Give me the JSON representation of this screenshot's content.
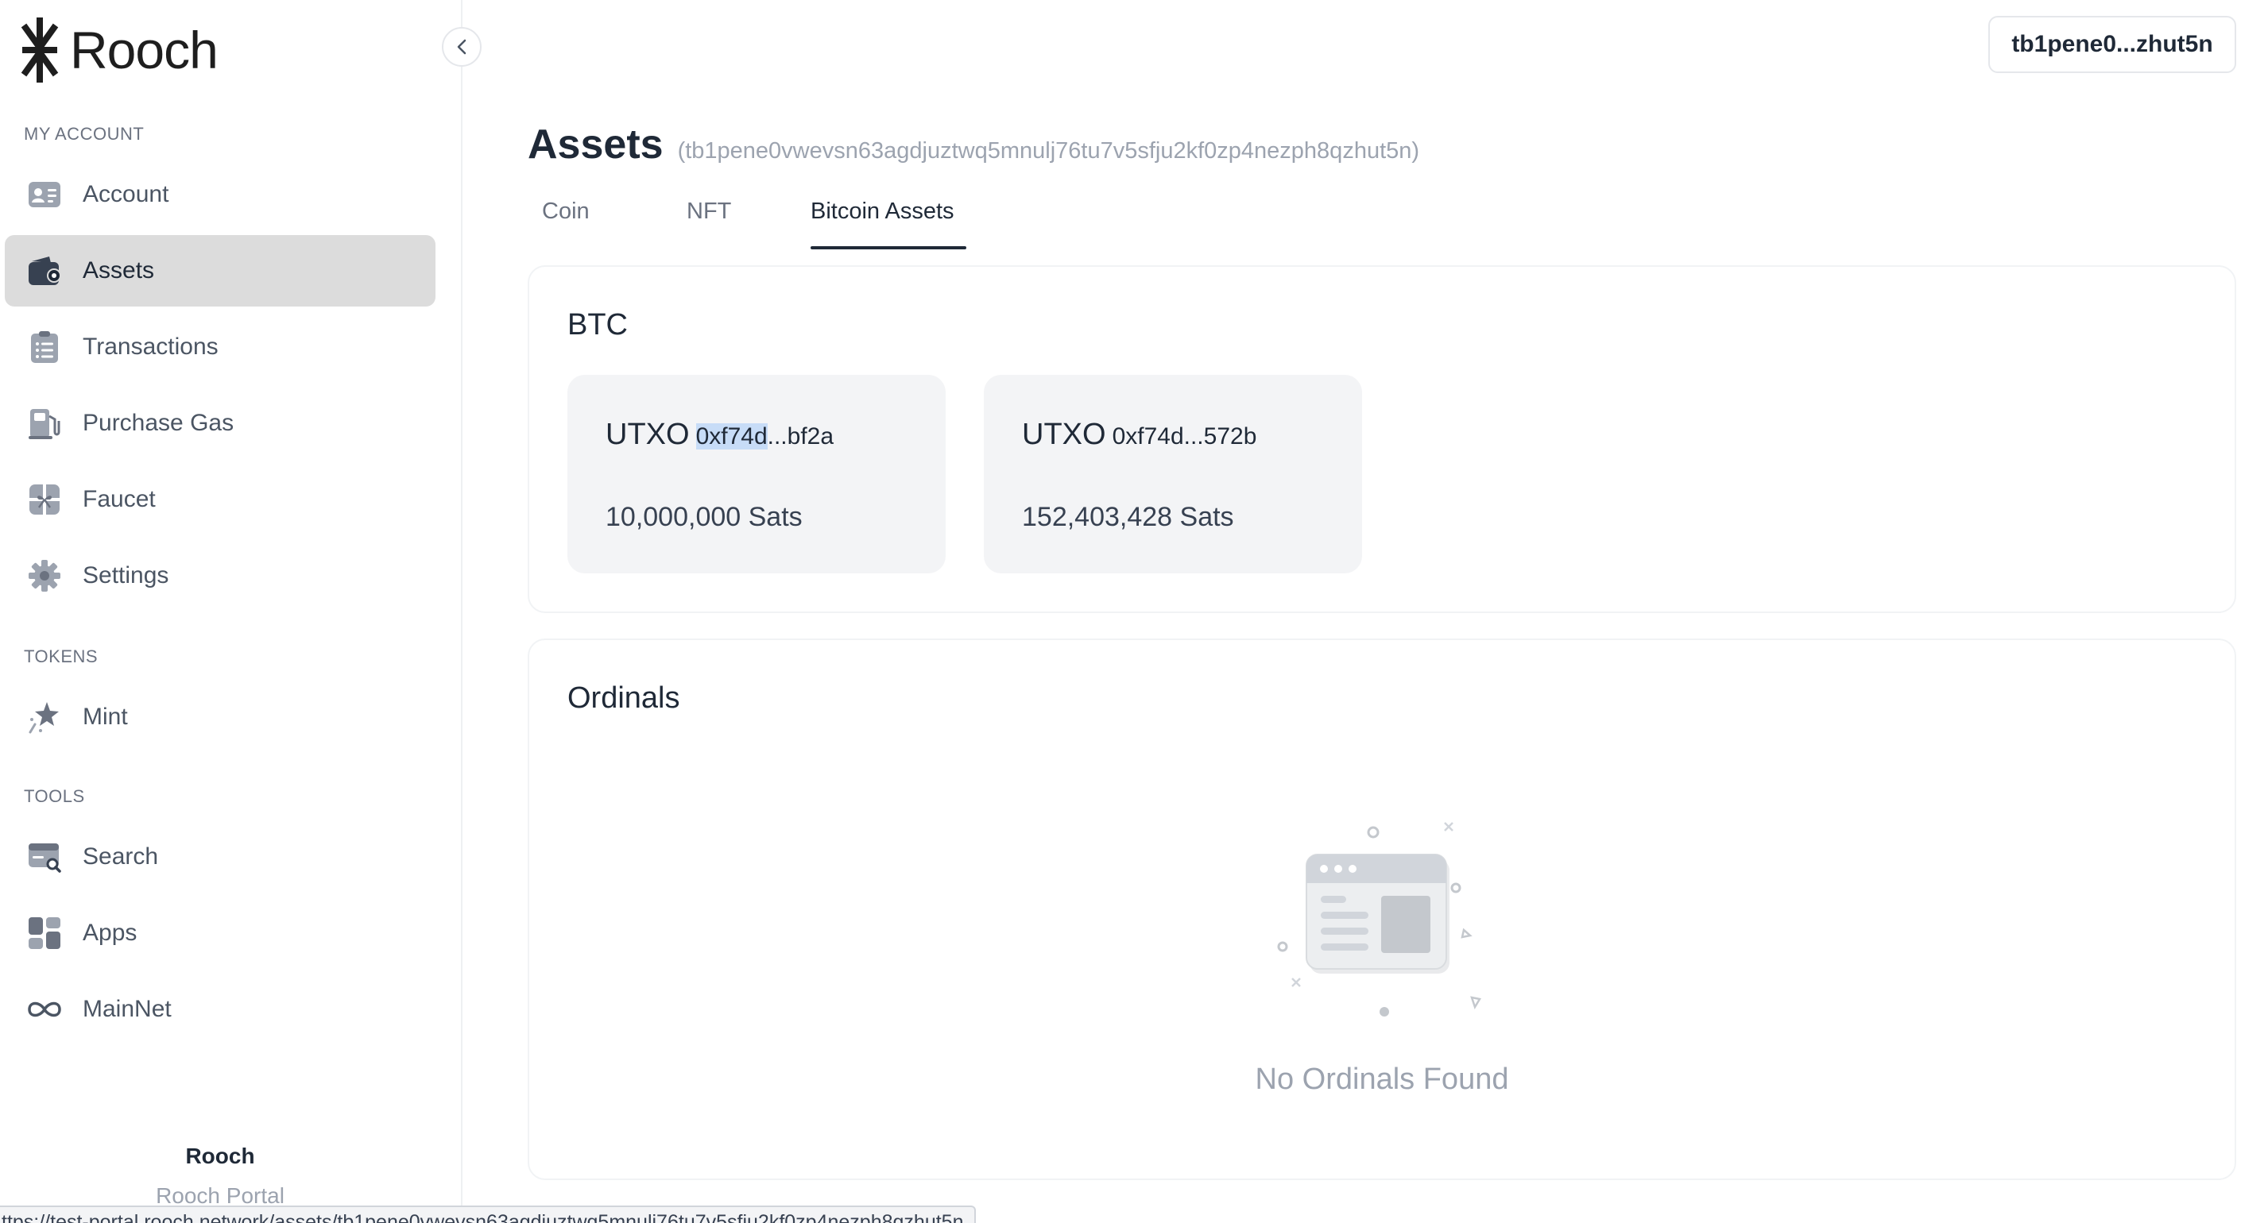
{
  "app": {
    "logo_text": "Rooch",
    "footer_title": "Rooch",
    "footer_subtitle": "Rooch Portal"
  },
  "sidebar": {
    "sections": {
      "my_account": "MY ACCOUNT",
      "tokens": "TOKENS",
      "tools": "TOOLS"
    },
    "items": [
      {
        "label": "Account",
        "icon": "account-card-icon"
      },
      {
        "label": "Assets",
        "icon": "wallet-icon",
        "active": true
      },
      {
        "label": "Transactions",
        "icon": "clipboard-list-icon"
      },
      {
        "label": "Purchase Gas",
        "icon": "gas-pump-icon"
      },
      {
        "label": "Faucet",
        "icon": "faucet-gift-icon"
      },
      {
        "label": "Settings",
        "icon": "gear-icon"
      },
      {
        "label": "Mint",
        "icon": "sparkle-star-icon"
      },
      {
        "label": "Search",
        "icon": "search-browser-icon"
      },
      {
        "label": "Apps",
        "icon": "apps-grid-icon"
      },
      {
        "label": "MainNet",
        "icon": "infinity-icon"
      }
    ]
  },
  "header": {
    "wallet_address_short": "tb1pene0...zhut5n"
  },
  "main": {
    "title": "Assets",
    "address": "(tb1pene0vwevsn63agdjuztwq5mnulj76tu7v5sfju2kf0zp4nezph8qzhut5n)",
    "tabs": [
      {
        "label": "Coin"
      },
      {
        "label": "NFT"
      },
      {
        "label": "Bitcoin Assets",
        "active": true
      }
    ],
    "btc": {
      "title": "BTC",
      "utxos": [
        {
          "label": "UTXO",
          "id_selected": "0xf74d",
          "id_rest": "...bf2a",
          "amount": "10,000,000 Sats"
        },
        {
          "label": "UTXO",
          "id": "0xf74d...572b",
          "amount": "152,403,428 Sats"
        }
      ]
    },
    "ordinals": {
      "title": "Ordinals",
      "empty_text": "No Ordinals Found"
    }
  },
  "status_bar": {
    "url": "ttps://test-portal.rooch.network/assets/tb1pene0vwevsn63agdjuztwq5mnulj76tu7v5sfju2kf0zp4nezph8qzhut5n"
  },
  "colors": {
    "active_nav_bg": "#dcdcdc",
    "text_primary": "#1f2937",
    "text_muted": "#9ca3af",
    "card_bg": "#f3f4f6",
    "selection": "#c7dcf7"
  }
}
